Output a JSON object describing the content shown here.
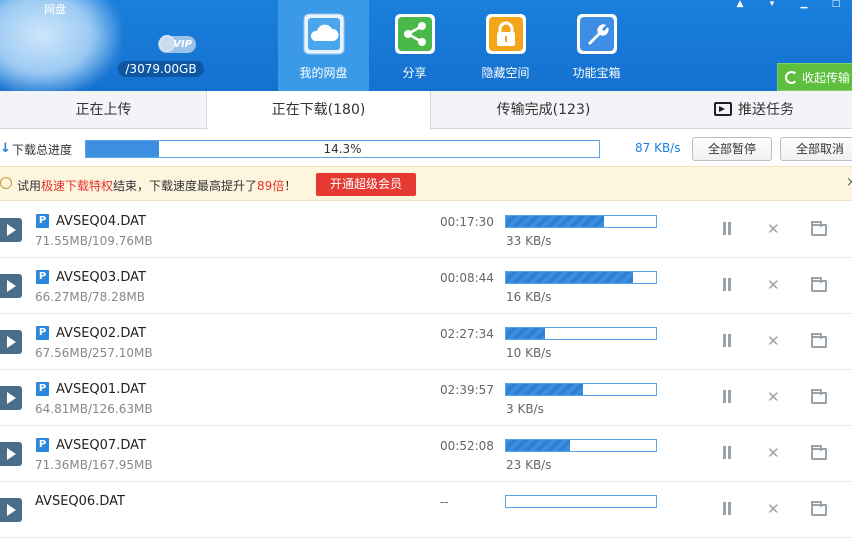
{
  "app": {
    "title": "网盘"
  },
  "user": {
    "vip_label": "VIP",
    "quota": "/3079.00GB"
  },
  "nav": [
    {
      "label": "我的网盘",
      "icon": "cloud-icon",
      "active": true
    },
    {
      "label": "分享",
      "icon": "share-icon",
      "active": false
    },
    {
      "label": "隐藏空间",
      "icon": "lock-icon",
      "active": false
    },
    {
      "label": "功能宝箱",
      "icon": "toolbox-icon",
      "active": false
    }
  ],
  "window_controls": [
    "pin",
    "dropdown",
    "minimize",
    "close"
  ],
  "collapse_label": "收起传输",
  "tabs": [
    {
      "label": "正在上传"
    },
    {
      "label": "正在下载(180)"
    },
    {
      "label": "传输完成(123)"
    },
    {
      "label": "推送任务"
    }
  ],
  "overall": {
    "label": "下载总进度",
    "percent_text": "14.3%",
    "progress": 0.143,
    "speed": "87 KB/s",
    "pause_all": "全部暂停",
    "cancel_all": "全部取消"
  },
  "notice": {
    "prefix": "试用",
    "highlight": "极速下载特权",
    "middle": "结束，下载速度最高提升了",
    "multiplier": "89倍",
    "suffix": "！",
    "button": "开通超级会员"
  },
  "downloads": [
    {
      "name": "AVSEQ04.DAT",
      "size": "71.55MB/109.76MB",
      "time": "00:17:30",
      "progress": 0.652,
      "speed": "33 KB/s",
      "badge": "P"
    },
    {
      "name": "AVSEQ03.DAT",
      "size": "66.27MB/78.28MB",
      "time": "00:08:44",
      "progress": 0.847,
      "speed": "16 KB/s",
      "badge": "P"
    },
    {
      "name": "AVSEQ02.DAT",
      "size": "67.56MB/257.10MB",
      "time": "02:27:34",
      "progress": 0.263,
      "speed": "10 KB/s",
      "badge": "P"
    },
    {
      "name": "AVSEQ01.DAT",
      "size": "64.81MB/126.63MB",
      "time": "02:39:57",
      "progress": 0.512,
      "speed": "3 KB/s",
      "badge": "P"
    },
    {
      "name": "AVSEQ07.DAT",
      "size": "71.36MB/167.95MB",
      "time": "00:52:08",
      "progress": 0.425,
      "speed": "23 KB/s",
      "badge": "P"
    },
    {
      "name": "AVSEQ06.DAT",
      "size": "",
      "time": "--",
      "progress": 0,
      "speed": "",
      "badge": ""
    }
  ],
  "colors": {
    "header": "#1a7fdc",
    "accent": "#3b8ee0",
    "warning": "#e43a32",
    "collapse": "#5dbf3d"
  }
}
